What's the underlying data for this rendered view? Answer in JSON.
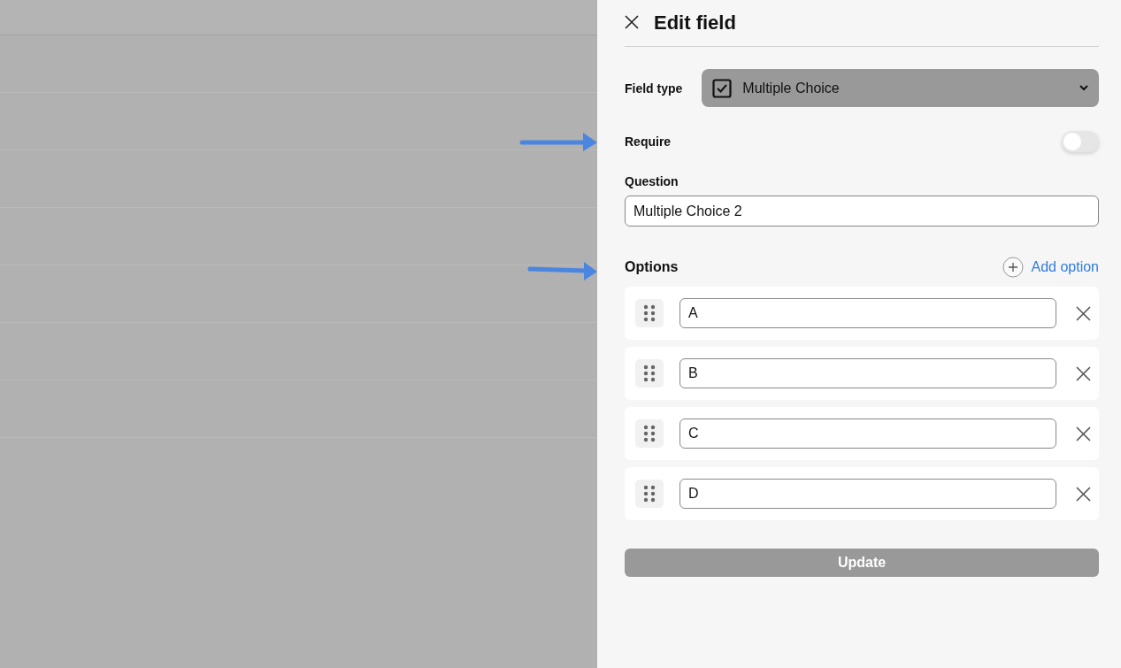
{
  "panel": {
    "title": "Edit field"
  },
  "field_type": {
    "label": "Field type",
    "value": "Multiple Choice"
  },
  "require": {
    "label": "Require",
    "on": false
  },
  "question": {
    "label": "Question",
    "value": "Multiple Choice 2"
  },
  "options": {
    "label": "Options",
    "add_label": "Add option",
    "items": [
      {
        "value": "A"
      },
      {
        "value": "B"
      },
      {
        "value": "C"
      },
      {
        "value": "D"
      }
    ]
  },
  "update_button": {
    "label": "Update",
    "disabled": true
  }
}
